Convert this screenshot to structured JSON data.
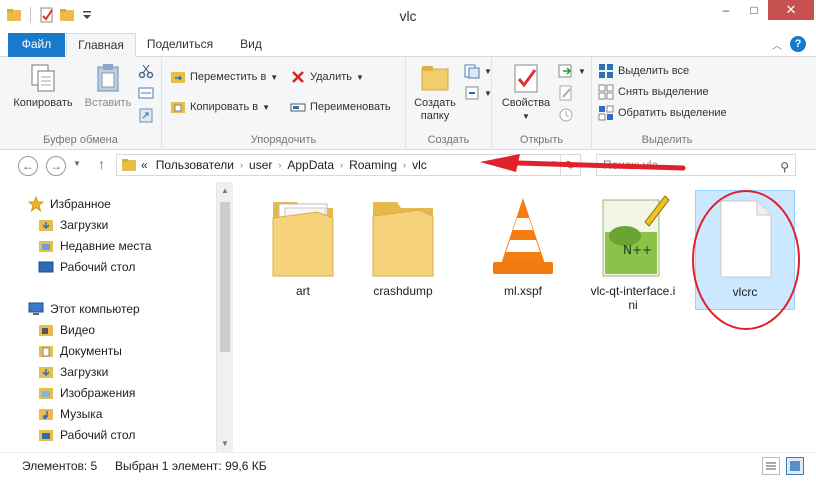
{
  "window": {
    "title": "vlc",
    "minimize": "–",
    "maximize": "□",
    "close": "✕"
  },
  "tabs": {
    "file": "Файл",
    "home": "Главная",
    "share": "Поделиться",
    "view": "Вид",
    "help": "?"
  },
  "ribbon": {
    "clipboard": {
      "label": "Буфер обмена",
      "copy": "Копировать",
      "paste": "Вставить"
    },
    "organize": {
      "label": "Упорядочить",
      "move_to": "Переместить в",
      "copy_to": "Копировать в",
      "delete": "Удалить",
      "rename": "Переименовать"
    },
    "new": {
      "label": "Создать",
      "new_folder_line1": "Создать",
      "new_folder_line2": "папку"
    },
    "open": {
      "label": "Открыть",
      "properties": "Свойства"
    },
    "select": {
      "label": "Выделить",
      "select_all": "Выделить все",
      "select_none": "Снять выделение",
      "invert": "Обратить выделение"
    }
  },
  "address": {
    "overflow": "«",
    "crumbs": [
      "Пользователи",
      "user",
      "AppData",
      "Roaming",
      "vlc"
    ],
    "search_placeholder": "Поиск: vlc"
  },
  "nav": {
    "favorites": "Избранное",
    "downloads": "Загрузки",
    "recent": "Недавние места",
    "desktop": "Рабочий стол",
    "this_pc": "Этот компьютер",
    "videos": "Видео",
    "documents": "Документы",
    "downloads2": "Загрузки",
    "pictures": "Изображения",
    "music": "Музыка",
    "desktop2": "Рабочий стол"
  },
  "files": [
    {
      "name": "art",
      "type": "folder"
    },
    {
      "name": "crashdump",
      "type": "folder"
    },
    {
      "name": "ml.xspf",
      "type": "vlc"
    },
    {
      "name": "vlc-qt-interface.i",
      "name2": "ni",
      "type": "notepad"
    },
    {
      "name": "vlcrc",
      "type": "blank",
      "selected": true
    }
  ],
  "status": {
    "count": "Элементов: 5",
    "selection": "Выбран 1 элемент: 99,6 КБ"
  },
  "colors": {
    "accent": "#1979ca",
    "annotation_red": "#e0202a",
    "selection_bg": "#cce8ff",
    "folder": "#f2cd6b"
  }
}
